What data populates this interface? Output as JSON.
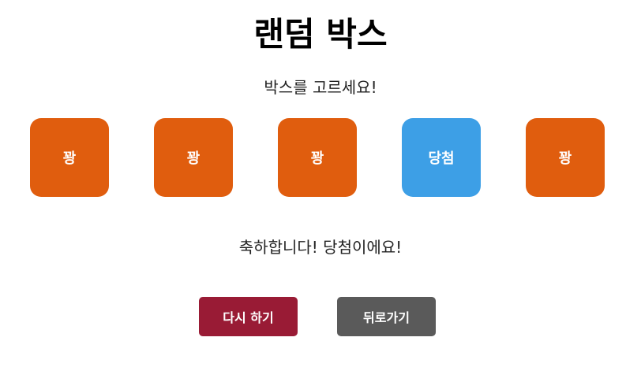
{
  "title": "랜덤 박스",
  "subtitle": "박스를 고르세요!",
  "boxes": [
    {
      "label": "꽝",
      "state": "lose"
    },
    {
      "label": "꽝",
      "state": "lose"
    },
    {
      "label": "꽝",
      "state": "lose"
    },
    {
      "label": "당첨",
      "state": "win"
    },
    {
      "label": "꽝",
      "state": "lose"
    }
  ],
  "result_message": "축하합니다! 당첨이에요!",
  "buttons": {
    "retry_label": "다시 하기",
    "back_label": "뒤로가기"
  },
  "colors": {
    "lose_box": "#e05d0e",
    "win_box": "#3d9fe6",
    "retry_button": "#991b35",
    "back_button": "#5a5a5a"
  }
}
